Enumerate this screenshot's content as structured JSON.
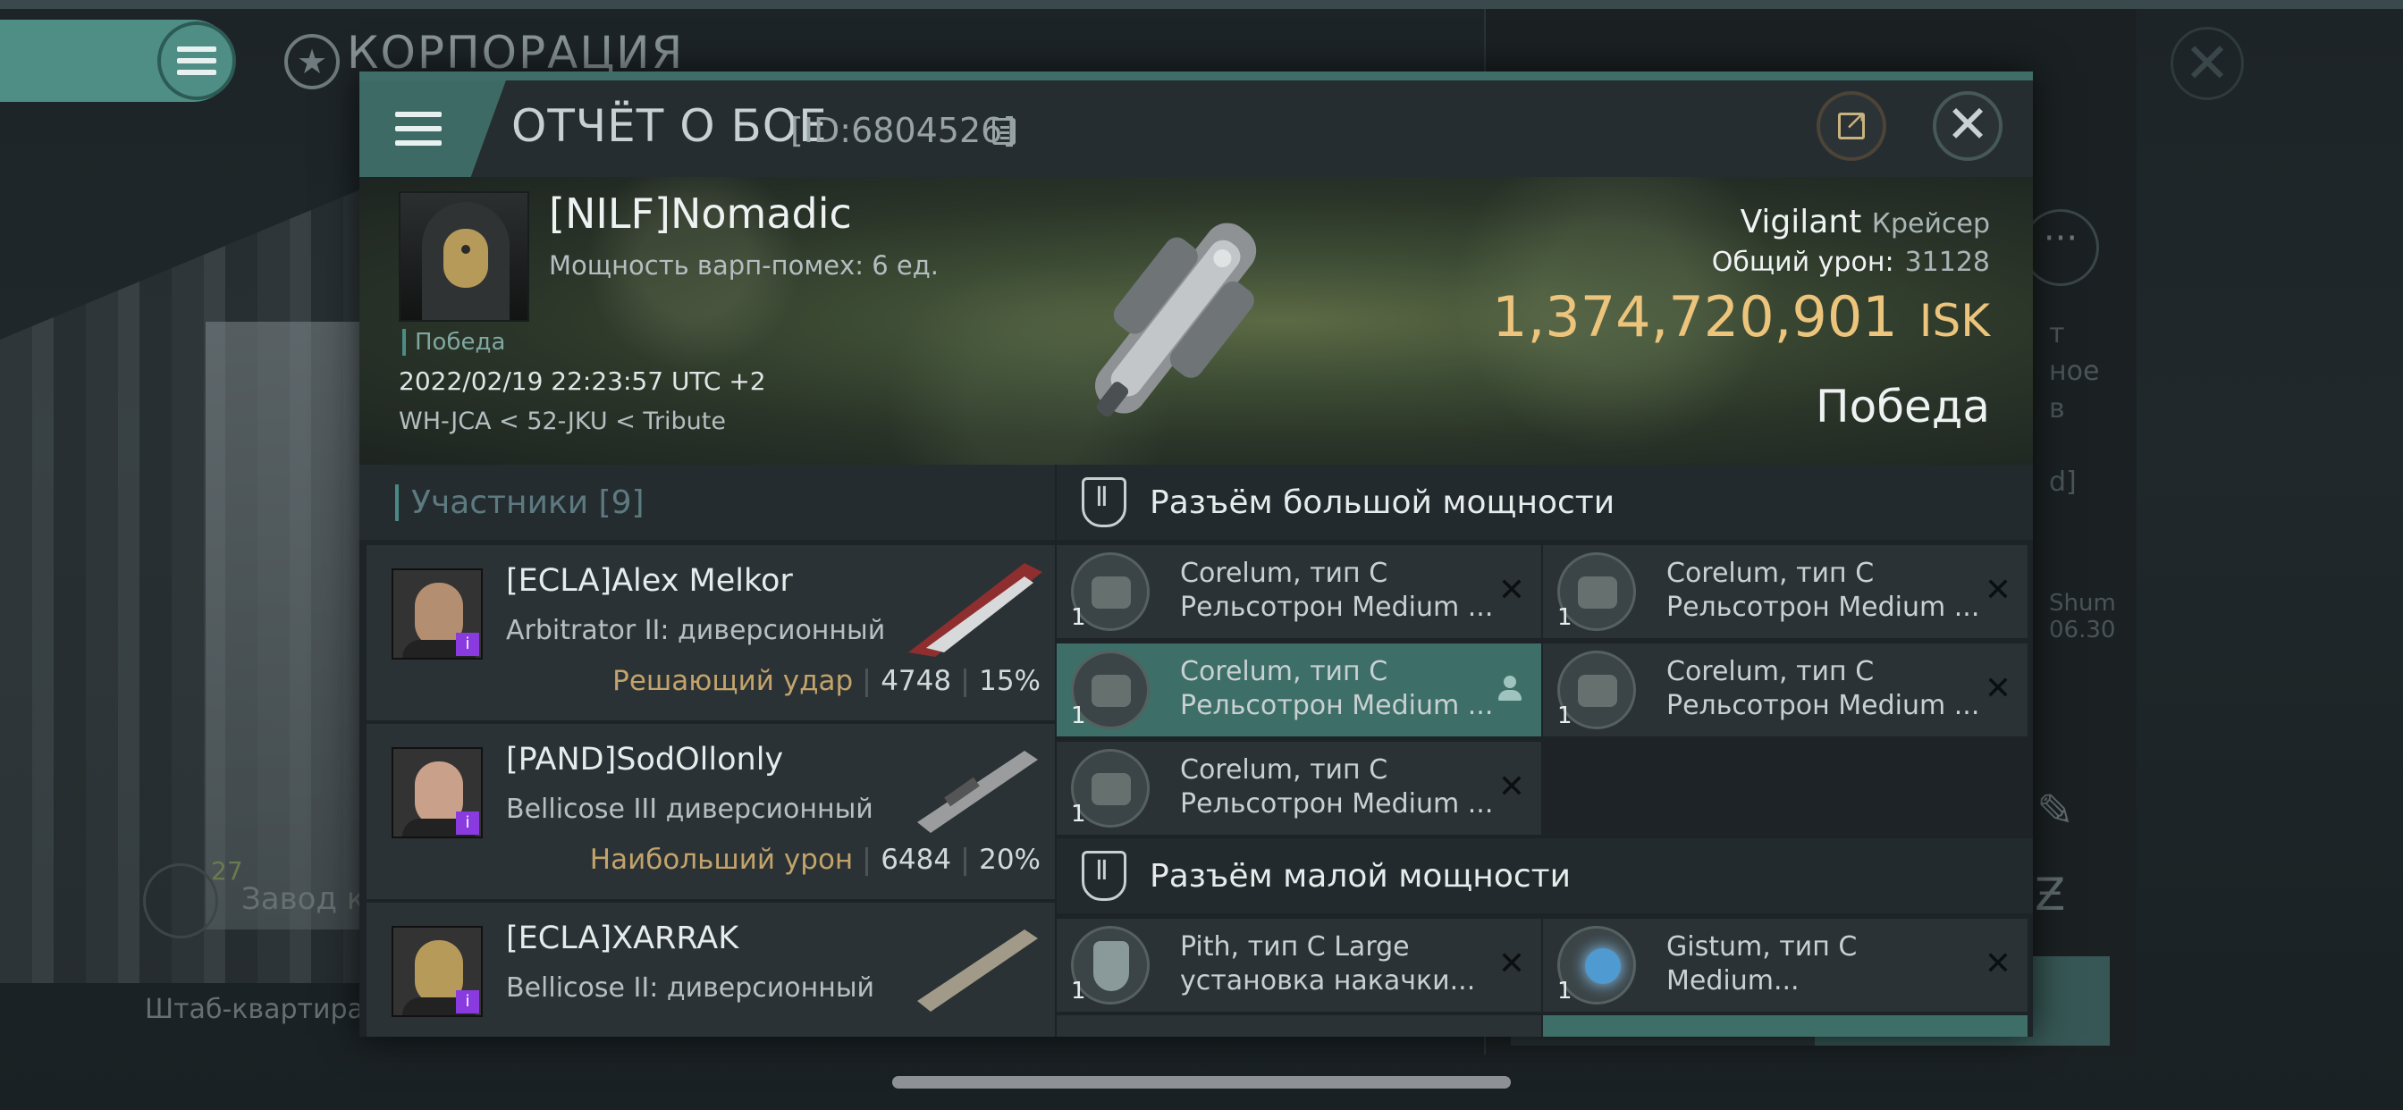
{
  "background": {
    "corp_title": "КОРПОРАЦИЯ",
    "side_texts": [
      "т",
      "ное",
      "в",
      "d]",
      "Shum",
      "06.30"
    ],
    "factory_count": "27",
    "factory_label": "Завод к",
    "hq_label": "Штаб-квартира К",
    "close_symbol": "✕",
    "more_symbol": "···"
  },
  "header": {
    "title": "ОТЧЁТ О БОЕ",
    "id": "[ID:6804526]",
    "close_symbol": "✕"
  },
  "victim": {
    "pilot": "[NILF]Nomadic",
    "warp": "Мощность варп-помех: 6 ед.",
    "status_small": "Победа",
    "datetime": "2022/02/19 22:23:57 UTC +2",
    "location": "WH-JCA < 52-JKU < Tribute",
    "ship": "Vigilant",
    "ship_class": "Крейсер",
    "damage_label": "Общий урон:",
    "damage_value": "31128",
    "isk_value": "1,374,720,901",
    "isk_currency": "ISK",
    "result": "Победа"
  },
  "participants": {
    "title": "Участники [9]",
    "rows": [
      {
        "name": "[ECLA]Alex Melkor",
        "ship": "Arbitrator II: диверсионный",
        "role": "Решающий удар",
        "damage": "4748",
        "percent": "15%"
      },
      {
        "name": "[PAND]SodOllonly",
        "ship": "Bellicose III диверсионный",
        "role": "Наибольший урон",
        "damage": "6484",
        "percent": "20%"
      },
      {
        "name": "[ECLA]XARRAK",
        "ship": "Bellicose II: диверсионный",
        "role": "",
        "damage": "",
        "percent": ""
      }
    ]
  },
  "modules": {
    "high_title": "Разъём большой мощности",
    "low_title": "Разъём малой мощности",
    "high": [
      {
        "line1": "Corelum, тип C",
        "line2": "Рельсотрон Medium ...",
        "qty": "1",
        "status": "destroyed"
      },
      {
        "line1": "Corelum, тип C",
        "line2": "Рельсотрон Medium ...",
        "qty": "1",
        "status": "destroyed"
      },
      {
        "line1": "Corelum, тип C",
        "line2": "Рельсотрон Medium ...",
        "qty": "1",
        "status": "dropped"
      },
      {
        "line1": "Corelum, тип C",
        "line2": "Рельсотрон Medium ...",
        "qty": "1",
        "status": "destroyed"
      },
      {
        "line1": "Corelum, тип C",
        "line2": "Рельсотрон Medium ...",
        "qty": "1",
        "status": "destroyed"
      }
    ],
    "low": [
      {
        "line1": "Pith, тип C Large",
        "line2": "установка накачки...",
        "qty": "1",
        "status": "destroyed"
      },
      {
        "line1": "Gistum, тип C",
        "line2": "Medium...",
        "qty": "1",
        "status": "destroyed"
      }
    ],
    "destroyed_symbol": "✕"
  },
  "colors": {
    "accent": "#4e8e84",
    "isk": "#ecc47c",
    "role": "#c3a36b",
    "highlight_row": "#3d6e68"
  }
}
